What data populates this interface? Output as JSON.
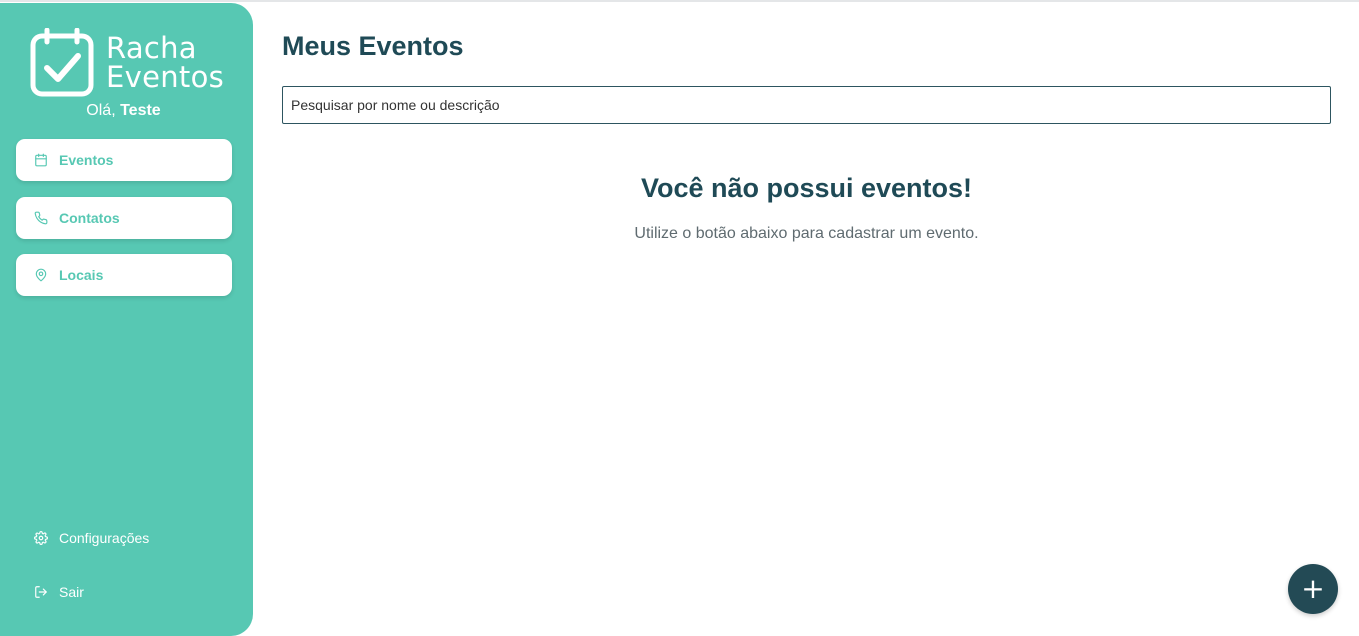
{
  "brand": {
    "line1": "Racha",
    "line2": "Eventos"
  },
  "greeting": {
    "prefix": "Olá, ",
    "user": "Teste"
  },
  "sidebar": {
    "items": [
      {
        "label": "Eventos",
        "icon": "calendar-icon"
      },
      {
        "label": "Contatos",
        "icon": "phone-icon"
      },
      {
        "label": "Locais",
        "icon": "map-pin-icon"
      }
    ],
    "settings_label": "Configurações",
    "logout_label": "Sair"
  },
  "main": {
    "title": "Meus Eventos",
    "search_placeholder": "Pesquisar por nome ou descrição",
    "empty_title": "Você não possui eventos!",
    "empty_subtitle": "Utilize o botão abaixo para cadastrar um evento."
  },
  "fab": {
    "label": "+",
    "icon": "plus-icon"
  },
  "colors": {
    "accent": "#57c8b3",
    "dark": "#1f4a56",
    "fab": "#234a55"
  }
}
